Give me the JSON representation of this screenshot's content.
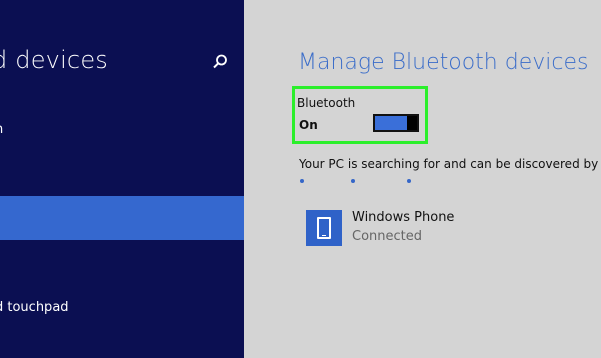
{
  "sidebar": {
    "title": "d devices",
    "items": [
      {
        "label": "n"
      },
      {
        "label": ""
      },
      {
        "label": "d touchpad"
      }
    ]
  },
  "main": {
    "title": "Manage Bluetooth devices",
    "bluetooth": {
      "label": "Bluetooth",
      "state": "On"
    },
    "status_text": "Your PC is searching for and can be discovered by Blu",
    "devices": [
      {
        "name": "Windows Phone",
        "status": "Connected",
        "icon": "phone-icon"
      }
    ]
  },
  "colors": {
    "sidebar_bg": "#0b0f52",
    "selected_bg": "#3568cf",
    "accent": "#3b6dc9",
    "highlight_border": "#2bef2b"
  }
}
